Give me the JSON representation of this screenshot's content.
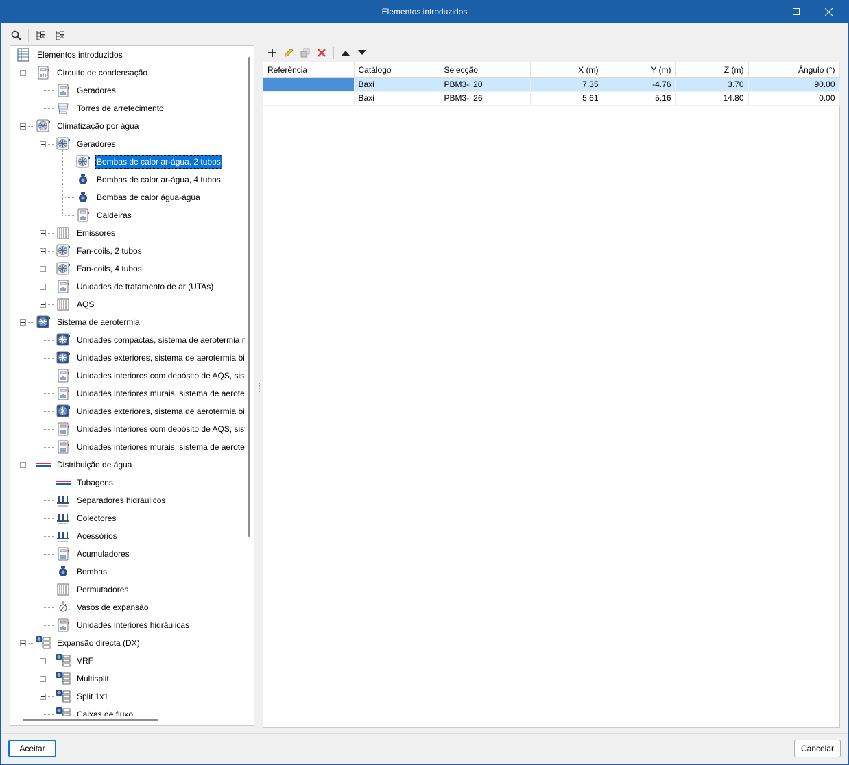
{
  "window": {
    "title": "Elementos introduzidos"
  },
  "tree": {
    "root": "Elementos introduzidos",
    "items": [
      {
        "label": "Circuito de condensação",
        "icon": "condensation-circuit-icon"
      },
      {
        "label": "Geradores",
        "icon": "generator-icon"
      },
      {
        "label": "Torres de arrefecimento",
        "icon": "cooling-tower-icon"
      },
      {
        "label": "Climatização por água",
        "icon": "water-climatization-icon"
      },
      {
        "label": "Geradores",
        "icon": "fan-generator-icon"
      },
      {
        "label": "Bombas de calor ar-água, 2 tubos",
        "icon": "fan-unit-icon",
        "selected": true
      },
      {
        "label": "Bombas de calor ar-água, 4 tubos",
        "icon": "heat-pump-4-tubes-icon"
      },
      {
        "label": "Bombas de calor água-água",
        "icon": "water-water-heat-pump-icon"
      },
      {
        "label": "Caldeiras",
        "icon": "boiler-icon"
      },
      {
        "label": "Emissores",
        "icon": "radiator-icon"
      },
      {
        "label": "Fan-coils, 2 tubos",
        "icon": "fan-coil-icon"
      },
      {
        "label": "Fan-coils, 4 tubos",
        "icon": "fan-coil-4-tubes-icon"
      },
      {
        "label": "Unidades de tratamento de ar (UTAs)",
        "icon": "air-handling-unit-icon"
      },
      {
        "label": "AQS",
        "icon": "dhw-icon"
      },
      {
        "label": "Sistema de aerotermia",
        "icon": "aerothermal-system-icon"
      },
      {
        "label": "Unidades compactas, sistema de aerotermia mo",
        "icon": "compact-unit-icon"
      },
      {
        "label": "Unidades exteriores, sistema de aerotermia bibl",
        "icon": "outdoor-unit-icon"
      },
      {
        "label": "Unidades interiores com depósito de AQS, siste",
        "icon": "indoor-unit-tank-icon"
      },
      {
        "label": "Unidades interiores murais, sistema de aerotern",
        "icon": "wall-indoor-unit-icon"
      },
      {
        "label": "Unidades exteriores, sistema de aerotermia bibl",
        "icon": "outdoor-unit-icon"
      },
      {
        "label": "Unidades interiores com depósito de AQS, siste",
        "icon": "indoor-unit-tank-icon"
      },
      {
        "label": "Unidades interiores murais, sistema de aerotern",
        "icon": "wall-indoor-unit-icon"
      },
      {
        "label": "Distribuição de água",
        "icon": "water-distribution-icon"
      },
      {
        "label": "Tubagens",
        "icon": "pipes-icon"
      },
      {
        "label": "Separadores hidráulicos",
        "icon": "hydraulic-separator-icon"
      },
      {
        "label": "Colectores",
        "icon": "manifold-icon"
      },
      {
        "label": "Acessórios",
        "icon": "accessories-icon"
      },
      {
        "label": "Acumuladores",
        "icon": "accumulator-icon"
      },
      {
        "label": "Bombas",
        "icon": "pump-icon"
      },
      {
        "label": "Permutadores",
        "icon": "heat-exchanger-icon"
      },
      {
        "label": "Vasos de expansão",
        "icon": "expansion-vessel-icon"
      },
      {
        "label": "Unidades interiores hidráulicas",
        "icon": "hydraulic-indoor-unit-icon"
      },
      {
        "label": "Expansão directa (DX)",
        "icon": "direct-expansion-icon"
      },
      {
        "label": "VRF",
        "icon": "vrf-icon"
      },
      {
        "label": "Multisplit",
        "icon": "multisplit-icon"
      },
      {
        "label": "Split 1x1",
        "icon": "split-icon"
      },
      {
        "label": "Caixas de fluxo",
        "icon": "flow-box-icon"
      }
    ]
  },
  "table": {
    "columns": [
      "Referência",
      "Catálogo",
      "Selecção",
      "X (m)",
      "Y (m)",
      "Z (m)",
      "Ângulo (°)"
    ],
    "rows": [
      [
        "",
        "Baxi",
        "PBM3-i 20",
        "7.35",
        "-4.76",
        "3.70",
        "90.00"
      ],
      [
        "",
        "Baxi",
        "PBM3-i 26",
        "5.61",
        "5.16",
        "14.80",
        "0.00"
      ]
    ]
  },
  "buttons": {
    "accept": "Aceitar",
    "cancel": "Cancelar"
  },
  "colors": {
    "titlebar": "#1b5fa8",
    "selection": "#0a74d9",
    "row_selection": "#cce8ff",
    "delete": "#e03c3c"
  }
}
